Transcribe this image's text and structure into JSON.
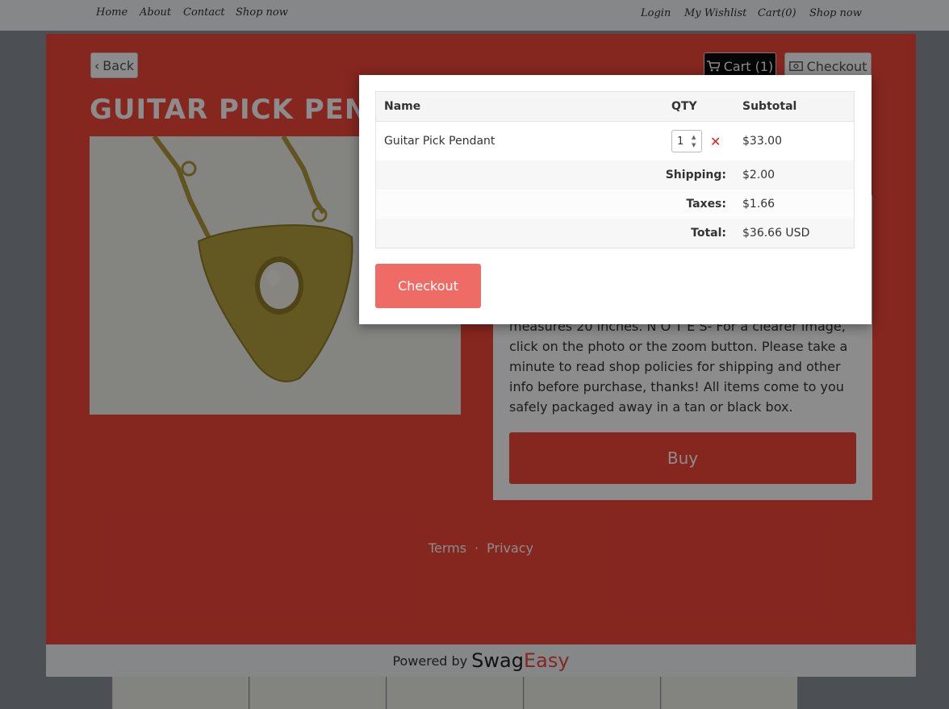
{
  "nav": {
    "left": [
      "Home",
      "About",
      "Contact",
      "Shop now"
    ],
    "right": [
      "Login",
      "My Wishlist",
      "Cart(0)",
      "Shop now"
    ]
  },
  "shop": {
    "back_label": "Back",
    "cart_label": "Cart (1)",
    "checkout_label": "Checkout",
    "product_title": "GUITAR PICK PENDANT",
    "description": "measures 20 inches. N O T E S- For a clearer image, click on the photo or the zoom button. Please take a minute to read shop policies for shipping and other info before purchase, thanks! All items come to you safely packaged away in a tan or black box.",
    "buy_label": "Buy",
    "footer": {
      "terms": "Terms",
      "sep": "·",
      "privacy": "Privacy"
    },
    "powered_by": "Powered by",
    "brand_a": "Swag",
    "brand_b": "Easy",
    "accent_color": "#f2463a"
  },
  "cart": {
    "headers": {
      "name": "Name",
      "qty": "QTY",
      "subtotal": "Subtotal"
    },
    "item": {
      "name": "Guitar Pick Pendant",
      "qty": "1",
      "subtotal": "$33.00"
    },
    "shipping": {
      "label": "Shipping:",
      "value": "$2.00"
    },
    "taxes": {
      "label": "Taxes:",
      "value": "$1.66"
    },
    "total": {
      "label": "Total:",
      "value": "$36.66 USD"
    },
    "checkout_label": "Checkout",
    "checkout_color": "#ef6c66"
  }
}
